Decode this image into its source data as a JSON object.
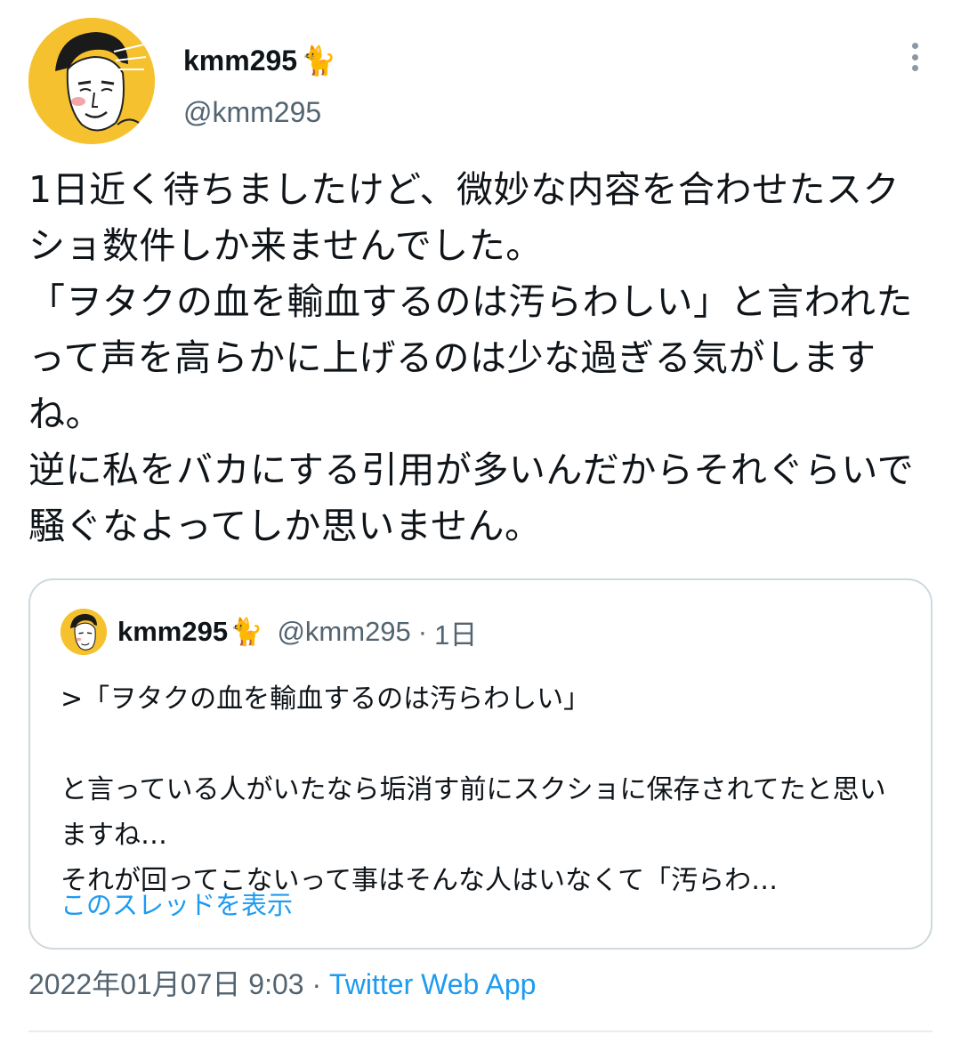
{
  "author": {
    "display_name": "kmm295",
    "name_emoji": "🐈",
    "handle": "@kmm295",
    "avatar_icon": "user-avatar-illustration"
  },
  "tweet": {
    "text": "1日近く待ちましたけど、微妙な内容を合わせたスクショ数件しか来ませんでした。\n「ヲタクの血を輸血するのは汚らわしい」と言われたって声を高らかに上げるのは少な過ぎる気がしますね。\n逆に私をバカにする引用が多いんだからそれぐらいで騒ぐなよってしか思いません。"
  },
  "quote": {
    "display_name": "kmm295",
    "name_emoji": "🐈",
    "handle": "@kmm295",
    "separator": "·",
    "age": "1日",
    "text": ">「ヲタクの血を輸血するのは汚らわしい」\n\nと言っている人がいたなら垢消す前にスクショに保存されてたと思いますね…\nそれが回ってこないって事はそんな人はいなくて「汚らわ…",
    "thread_link": "このスレッドを表示"
  },
  "meta": {
    "timestamp": "2022年01月07日 9:03",
    "separator": " · ",
    "source": "Twitter Web App"
  },
  "colors": {
    "link": "#1d9bf0",
    "secondary_text": "#536471",
    "border": "#cfd9de",
    "avatar_bg": "#f5c12e"
  }
}
